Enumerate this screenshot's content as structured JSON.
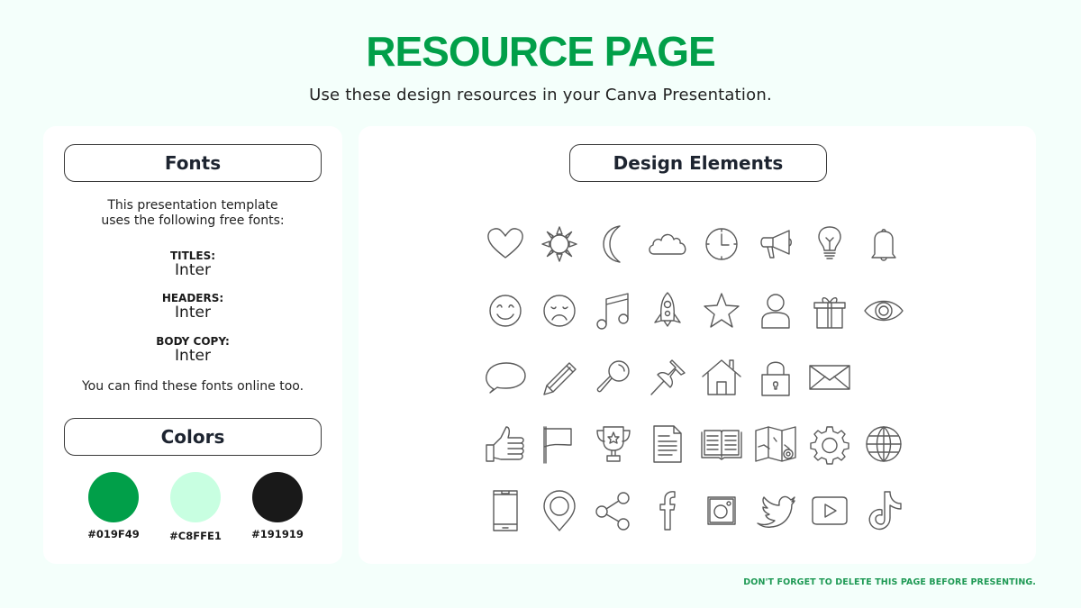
{
  "header": {
    "title": "RESOURCE PAGE",
    "subtitle": "Use these design resources in your Canva Presentation."
  },
  "fonts_panel": {
    "heading": "Fonts",
    "intro_line1": "This presentation template",
    "intro_line2": "uses the following free fonts:",
    "entries": [
      {
        "label": "TITLES:",
        "font": "Inter"
      },
      {
        "label": "HEADERS:",
        "font": "Inter"
      },
      {
        "label": "BODY COPY:",
        "font": "Inter"
      }
    ],
    "note": "You can find these fonts online too."
  },
  "colors_panel": {
    "heading": "Colors",
    "swatches": [
      {
        "label": "#019F49",
        "hex": "#019F49"
      },
      {
        "label": "#C8FFE1",
        "hex": "#C8FFE1"
      },
      {
        "label": "#191919",
        "hex": "#191919"
      }
    ]
  },
  "design_panel": {
    "heading": "Design Elements",
    "icons": [
      "heart-icon",
      "sun-icon",
      "moon-icon",
      "cloud-icon",
      "clock-icon",
      "megaphone-icon",
      "lightbulb-icon",
      "bell-icon",
      "smile-face-icon",
      "sad-face-icon",
      "music-note-icon",
      "rocket-icon",
      "star-icon",
      "user-icon",
      "gift-icon",
      "eye-icon",
      "speech-bubble-icon",
      "pencil-icon",
      "magnifier-icon",
      "pushpin-icon",
      "house-icon",
      "padlock-icon",
      "envelope-icon",
      "thumbs-up-icon",
      "flag-icon",
      "trophy-icon",
      "document-icon",
      "open-book-icon",
      "map-icon",
      "gear-icon",
      "globe-icon",
      "smartphone-icon",
      "location-pin-icon",
      "share-icon",
      "facebook-icon",
      "instagram-icon",
      "twitter-icon",
      "youtube-icon",
      "tiktok-icon"
    ]
  },
  "footer": {
    "note": "DON'T FORGET TO DELETE THIS PAGE BEFORE PRESENTING."
  }
}
